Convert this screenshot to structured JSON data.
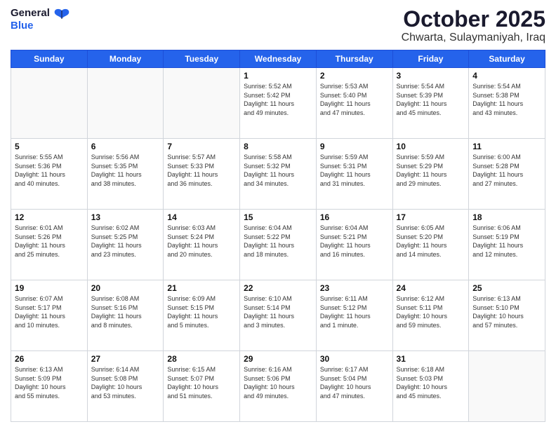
{
  "header": {
    "logo_general": "General",
    "logo_blue": "Blue",
    "month_year": "October 2025",
    "location": "Chwarta, Sulaymaniyah, Iraq"
  },
  "weekdays": [
    "Sunday",
    "Monday",
    "Tuesday",
    "Wednesday",
    "Thursday",
    "Friday",
    "Saturday"
  ],
  "weeks": [
    [
      {
        "day": "",
        "info": ""
      },
      {
        "day": "",
        "info": ""
      },
      {
        "day": "",
        "info": ""
      },
      {
        "day": "1",
        "info": "Sunrise: 5:52 AM\nSunset: 5:42 PM\nDaylight: 11 hours\nand 49 minutes."
      },
      {
        "day": "2",
        "info": "Sunrise: 5:53 AM\nSunset: 5:40 PM\nDaylight: 11 hours\nand 47 minutes."
      },
      {
        "day": "3",
        "info": "Sunrise: 5:54 AM\nSunset: 5:39 PM\nDaylight: 11 hours\nand 45 minutes."
      },
      {
        "day": "4",
        "info": "Sunrise: 5:54 AM\nSunset: 5:38 PM\nDaylight: 11 hours\nand 43 minutes."
      }
    ],
    [
      {
        "day": "5",
        "info": "Sunrise: 5:55 AM\nSunset: 5:36 PM\nDaylight: 11 hours\nand 40 minutes."
      },
      {
        "day": "6",
        "info": "Sunrise: 5:56 AM\nSunset: 5:35 PM\nDaylight: 11 hours\nand 38 minutes."
      },
      {
        "day": "7",
        "info": "Sunrise: 5:57 AM\nSunset: 5:33 PM\nDaylight: 11 hours\nand 36 minutes."
      },
      {
        "day": "8",
        "info": "Sunrise: 5:58 AM\nSunset: 5:32 PM\nDaylight: 11 hours\nand 34 minutes."
      },
      {
        "day": "9",
        "info": "Sunrise: 5:59 AM\nSunset: 5:31 PM\nDaylight: 11 hours\nand 31 minutes."
      },
      {
        "day": "10",
        "info": "Sunrise: 5:59 AM\nSunset: 5:29 PM\nDaylight: 11 hours\nand 29 minutes."
      },
      {
        "day": "11",
        "info": "Sunrise: 6:00 AM\nSunset: 5:28 PM\nDaylight: 11 hours\nand 27 minutes."
      }
    ],
    [
      {
        "day": "12",
        "info": "Sunrise: 6:01 AM\nSunset: 5:26 PM\nDaylight: 11 hours\nand 25 minutes."
      },
      {
        "day": "13",
        "info": "Sunrise: 6:02 AM\nSunset: 5:25 PM\nDaylight: 11 hours\nand 23 minutes."
      },
      {
        "day": "14",
        "info": "Sunrise: 6:03 AM\nSunset: 5:24 PM\nDaylight: 11 hours\nand 20 minutes."
      },
      {
        "day": "15",
        "info": "Sunrise: 6:04 AM\nSunset: 5:22 PM\nDaylight: 11 hours\nand 18 minutes."
      },
      {
        "day": "16",
        "info": "Sunrise: 6:04 AM\nSunset: 5:21 PM\nDaylight: 11 hours\nand 16 minutes."
      },
      {
        "day": "17",
        "info": "Sunrise: 6:05 AM\nSunset: 5:20 PM\nDaylight: 11 hours\nand 14 minutes."
      },
      {
        "day": "18",
        "info": "Sunrise: 6:06 AM\nSunset: 5:19 PM\nDaylight: 11 hours\nand 12 minutes."
      }
    ],
    [
      {
        "day": "19",
        "info": "Sunrise: 6:07 AM\nSunset: 5:17 PM\nDaylight: 11 hours\nand 10 minutes."
      },
      {
        "day": "20",
        "info": "Sunrise: 6:08 AM\nSunset: 5:16 PM\nDaylight: 11 hours\nand 8 minutes."
      },
      {
        "day": "21",
        "info": "Sunrise: 6:09 AM\nSunset: 5:15 PM\nDaylight: 11 hours\nand 5 minutes."
      },
      {
        "day": "22",
        "info": "Sunrise: 6:10 AM\nSunset: 5:14 PM\nDaylight: 11 hours\nand 3 minutes."
      },
      {
        "day": "23",
        "info": "Sunrise: 6:11 AM\nSunset: 5:12 PM\nDaylight: 11 hours\nand 1 minute."
      },
      {
        "day": "24",
        "info": "Sunrise: 6:12 AM\nSunset: 5:11 PM\nDaylight: 10 hours\nand 59 minutes."
      },
      {
        "day": "25",
        "info": "Sunrise: 6:13 AM\nSunset: 5:10 PM\nDaylight: 10 hours\nand 57 minutes."
      }
    ],
    [
      {
        "day": "26",
        "info": "Sunrise: 6:13 AM\nSunset: 5:09 PM\nDaylight: 10 hours\nand 55 minutes."
      },
      {
        "day": "27",
        "info": "Sunrise: 6:14 AM\nSunset: 5:08 PM\nDaylight: 10 hours\nand 53 minutes."
      },
      {
        "day": "28",
        "info": "Sunrise: 6:15 AM\nSunset: 5:07 PM\nDaylight: 10 hours\nand 51 minutes."
      },
      {
        "day": "29",
        "info": "Sunrise: 6:16 AM\nSunset: 5:06 PM\nDaylight: 10 hours\nand 49 minutes."
      },
      {
        "day": "30",
        "info": "Sunrise: 6:17 AM\nSunset: 5:04 PM\nDaylight: 10 hours\nand 47 minutes."
      },
      {
        "day": "31",
        "info": "Sunrise: 6:18 AM\nSunset: 5:03 PM\nDaylight: 10 hours\nand 45 minutes."
      },
      {
        "day": "",
        "info": ""
      }
    ]
  ]
}
